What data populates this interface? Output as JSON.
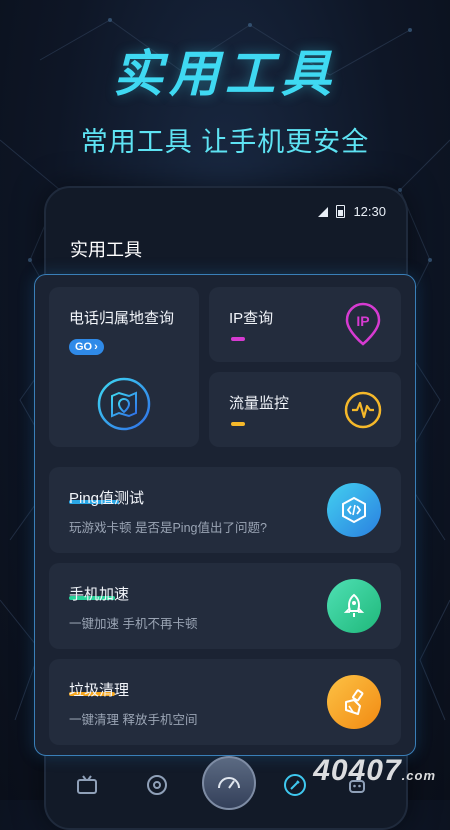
{
  "promo": {
    "headline": "实用工具",
    "subline": "常用工具 让手机更安全"
  },
  "status_bar": {
    "time": "12:30"
  },
  "app": {
    "title": "实用工具"
  },
  "tools": {
    "phone_location": {
      "title": "电话归属地查询",
      "badge": "GO",
      "icon": "map-pin-icon"
    },
    "ip_lookup": {
      "title": "IP查询",
      "icon_text": "IP",
      "accent": "#d63bd1"
    },
    "traffic_monitor": {
      "title": "流量监控",
      "icon": "waveform-icon",
      "accent": "#f5b82a"
    },
    "ping_test": {
      "title": "Ping值测试",
      "subtitle": "玩游戏卡顿 是否是Ping值出了问题?",
      "icon": "code-hexagon-icon",
      "accent": "#2aa7e6"
    },
    "phone_boost": {
      "title": "手机加速",
      "subtitle": "一键加速 手机不再卡顿",
      "icon": "rocket-icon",
      "accent": "#29d39a"
    },
    "junk_clean": {
      "title": "垃圾清理",
      "subtitle": "一键清理 释放手机空间",
      "icon": "broom-icon",
      "accent": "#f7a71d"
    }
  },
  "tabbar": {
    "items": [
      "tv-icon",
      "target-icon",
      "speedometer-icon",
      "tools-icon",
      "robot-icon"
    ]
  },
  "watermark": {
    "text": "40407",
    "suffix": ".com"
  }
}
